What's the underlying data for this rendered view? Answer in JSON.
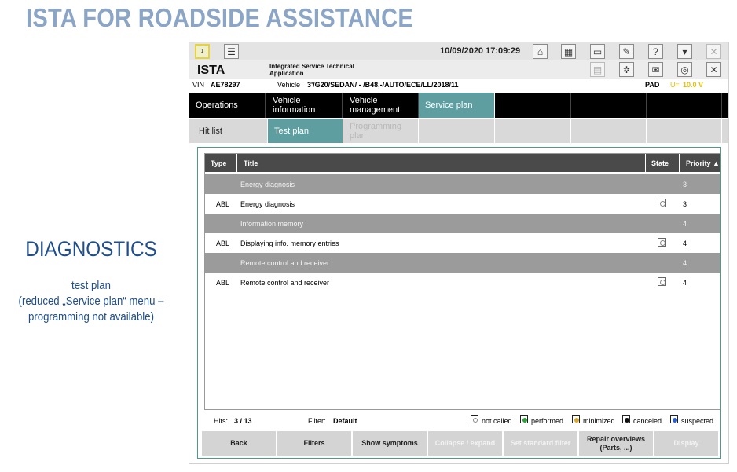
{
  "slide": {
    "title": "ISTA FOR ROADSIDE ASSISTANCE",
    "section": "DIAGNOSTICS",
    "desc1": "test plan",
    "desc2": "(reduced „Service plan“ menu –",
    "desc3": "programming not available)"
  },
  "app": {
    "datetime": "10/09/2020 17:09:29",
    "logo": "ISTA",
    "logo_sub": "Integrated Service Technical Application",
    "selected_index": "1",
    "vin_label": "VIN",
    "vin_value": "AE78297",
    "vehicle_label": "Vehicle",
    "vehicle_value": "3'/G20/SEDAN/ - /B48,-/AUTO/ECE/LL/2018/11",
    "pad_label": "PAD",
    "voltage_label": "U=",
    "voltage_value": "10.0 V",
    "voltage_color": "#e8c000"
  },
  "nav": {
    "items": [
      "Operations",
      "Vehicle information",
      "Vehicle management",
      "Service plan"
    ]
  },
  "subnav": {
    "items": [
      "Hit list",
      "Test plan",
      "Programming plan"
    ]
  },
  "table": {
    "headers": {
      "type": "Type",
      "title": "Title",
      "state": "State",
      "priority": "Priority ▲"
    },
    "rows": [
      {
        "kind": "group",
        "type": "",
        "title": "Energy diagnosis",
        "priority": "3"
      },
      {
        "kind": "item",
        "type": "ABL",
        "title": "Energy diagnosis",
        "priority": "3"
      },
      {
        "kind": "group",
        "type": "",
        "title": "Information memory",
        "priority": "4"
      },
      {
        "kind": "item",
        "type": "ABL",
        "title": "Displaying info. memory entries",
        "priority": "4"
      },
      {
        "kind": "group",
        "type": "",
        "title": "Remote control and receiver",
        "priority": "4"
      },
      {
        "kind": "item",
        "type": "ABL",
        "title": "Remote control and receiver",
        "priority": "4"
      }
    ]
  },
  "status": {
    "hits_label": "Hits:",
    "hits_value": "3 / 13",
    "filter_label": "Filter:",
    "filter_value": "Default",
    "legend": [
      {
        "label": "not called",
        "color": "#ffffff"
      },
      {
        "label": "performed",
        "color": "#2e9e3a"
      },
      {
        "label": "minimized",
        "color": "#d8a62a"
      },
      {
        "label": "canceled",
        "color": "#111111"
      },
      {
        "label": "suspected",
        "color": "#2a5fc8"
      }
    ]
  },
  "buttons": {
    "back": "Back",
    "filters": "Filters",
    "show_symptoms": "Show symptoms",
    "collapse": "Collapse / expand",
    "set_filter": "Set standard filter",
    "repair_1": "Repair overviews",
    "repair_2": "(Parts, ...)",
    "display": "Display"
  }
}
